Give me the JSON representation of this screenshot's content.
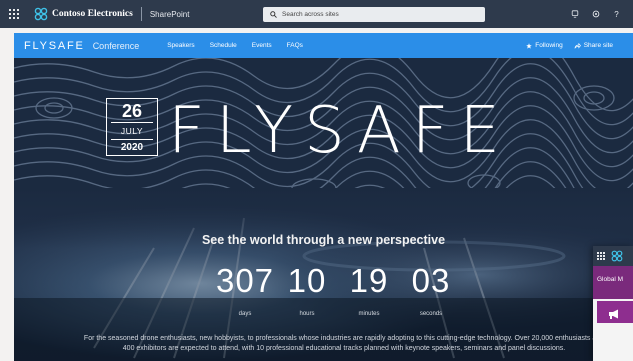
{
  "suitebar": {
    "org_name": "Contoso Electronics",
    "app_name": "SharePoint",
    "search_placeholder": "Search across sites",
    "icons": [
      "waffle-icon",
      "contoso-logo",
      "search-icon",
      "chat-icon",
      "settings-icon",
      "help-icon"
    ],
    "help_glyph": "?"
  },
  "site": {
    "logo_text": "FLYSAFE",
    "name": "Conference",
    "nav": [
      "Speakers",
      "Schedule",
      "Events",
      "FAQs"
    ],
    "following_label": "Following",
    "share_label": "Share site",
    "header_color": "#2b8ee8"
  },
  "hero": {
    "date": {
      "day": "26",
      "month": "JULY",
      "year": "2020"
    },
    "logo_text": "FLYSAFE",
    "tagline": "See the world through a new perspective",
    "countdown": [
      {
        "value": "307",
        "label": "days"
      },
      {
        "value": "10",
        "label": "hours"
      },
      {
        "value": "19",
        "label": "minutes"
      },
      {
        "value": "03",
        "label": "seconds"
      }
    ],
    "body_line_1": "For the seasoned drone enthusiasts, new hobbyists, to professionals whose industries are rapidly adopting to this cutting-edge technology. Over 20,000 enthusiasts and",
    "body_line_2": "400 exhibitors are expected to attend, with 10 professional educational tracks planned with keynote speakers, seminars and panel discussions."
  },
  "peek_window": {
    "header_text": "Global M"
  },
  "colors": {
    "suitebar": "#2e3a4c",
    "hero_dark": "#142236",
    "peek_header": "#7a2a7c"
  }
}
